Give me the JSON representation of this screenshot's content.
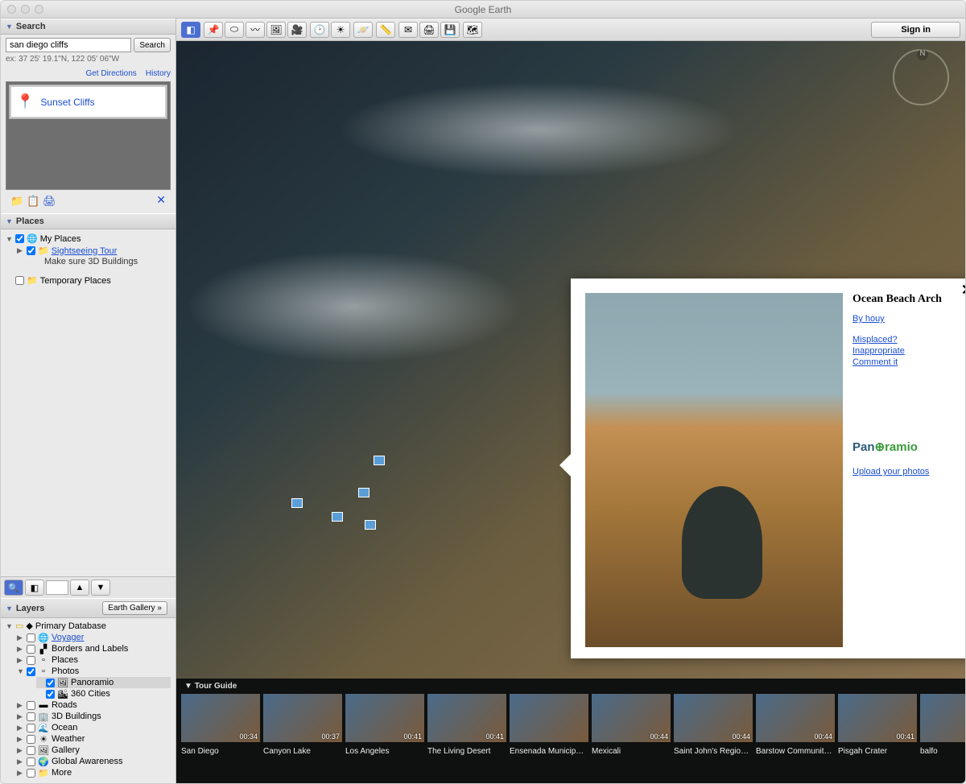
{
  "window": {
    "title": "Google Earth"
  },
  "toolbar": {
    "signin": "Sign in"
  },
  "search": {
    "header": "Search",
    "value": "san diego cliffs",
    "button": "Search",
    "example": "ex: 37 25' 19.1\"N, 122 05' 06\"W",
    "get_directions": "Get Directions",
    "history": "History",
    "result": "Sunset Cliffs"
  },
  "places": {
    "header": "Places",
    "my_places": "My Places",
    "sightseeing": "Sightseeing Tour",
    "sightseeing_note": "Make sure 3D Buildings",
    "temporary": "Temporary Places"
  },
  "layers": {
    "header": "Layers",
    "earth_gallery": "Earth Gallery  »",
    "primary_db": "Primary Database",
    "items": [
      {
        "label": "Voyager",
        "link": true,
        "icon": "🌐"
      },
      {
        "label": "Borders and Labels",
        "icon": "▞"
      },
      {
        "label": "Places",
        "icon": "▫"
      },
      {
        "label": "Photos",
        "icon": "▫",
        "expanded": true
      },
      {
        "label": "Panoramio",
        "icon": "🖼",
        "child": true,
        "selected": true
      },
      {
        "label": "360 Cities",
        "icon": "🏙",
        "child": true
      },
      {
        "label": "Roads",
        "icon": "▬"
      },
      {
        "label": "3D Buildings",
        "icon": "🏢"
      },
      {
        "label": "Ocean",
        "icon": "🌊"
      },
      {
        "label": "Weather",
        "icon": "☀"
      },
      {
        "label": "Gallery",
        "icon": "🖼"
      },
      {
        "label": "Global Awareness",
        "icon": "🌍"
      },
      {
        "label": "More",
        "icon": "📁"
      }
    ]
  },
  "popup": {
    "title": "Ocean Beach Arch",
    "author": "By houy",
    "misplaced": "Misplaced?",
    "inappropriate": "Inappropriate",
    "comment": "Comment it",
    "upload": "Upload your photos"
  },
  "tour_guide": {
    "header": "Tour Guide",
    "items": [
      {
        "label": "San Diego",
        "time": "00:34"
      },
      {
        "label": "Canyon Lake",
        "time": "00:37"
      },
      {
        "label": "Los Angeles",
        "time": "00:41"
      },
      {
        "label": "The Living Desert",
        "time": "00:41"
      },
      {
        "label": "Ensenada Municip…",
        "time": ""
      },
      {
        "label": "Mexicali",
        "time": "00:44"
      },
      {
        "label": "Saint John's Regio…",
        "time": "00:44"
      },
      {
        "label": "Barstow Communit…",
        "time": "00:44"
      },
      {
        "label": "Pisgah Crater",
        "time": "00:41"
      },
      {
        "label": "balfo",
        "time": ""
      }
    ]
  },
  "compass": {
    "n": "N"
  }
}
